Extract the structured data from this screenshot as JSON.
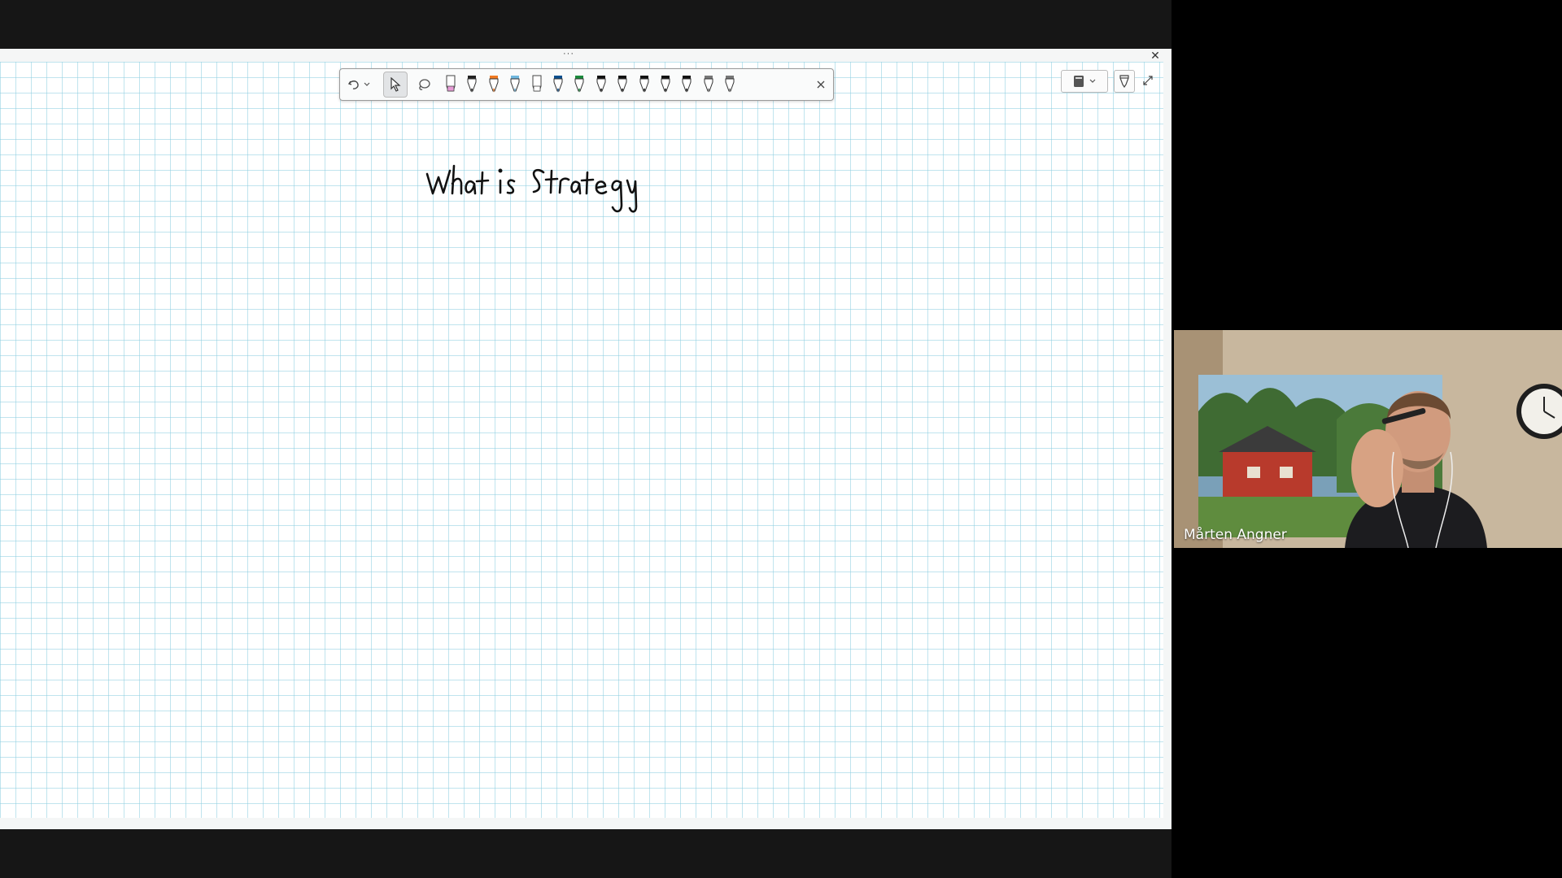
{
  "whiteboard": {
    "handwritten_text": "What is strategy",
    "grid_color": "#8ccde1",
    "toolbar": {
      "undo_icon": "undo-icon",
      "select_icon": "select-arrow-icon",
      "lasso_icon": "lasso-icon",
      "pens": [
        {
          "name": "highlighter-pink",
          "color": "#e79bd6"
        },
        {
          "name": "pen-black",
          "color": "#222222"
        },
        {
          "name": "pen-orange",
          "color": "#f07a22"
        },
        {
          "name": "pen-light-blue",
          "color": "#6fb7de"
        },
        {
          "name": "highlighter-white",
          "color": "#ffffff"
        },
        {
          "name": "pen-dark-blue",
          "color": "#0b4f8e"
        },
        {
          "name": "pen-green",
          "color": "#1b8a3c"
        },
        {
          "name": "pen-black-2",
          "color": "#111111"
        },
        {
          "name": "pen-black-3",
          "color": "#111111"
        },
        {
          "name": "pen-black-4",
          "color": "#111111"
        },
        {
          "name": "pen-black-5",
          "color": "#111111"
        },
        {
          "name": "pen-black-6",
          "color": "#111111"
        },
        {
          "name": "pen-gray",
          "color": "#777777"
        },
        {
          "name": "pen-gray-2",
          "color": "#777777"
        }
      ],
      "close_icon": "close-icon"
    }
  },
  "video": {
    "participant_name": "Mårten Angner"
  }
}
